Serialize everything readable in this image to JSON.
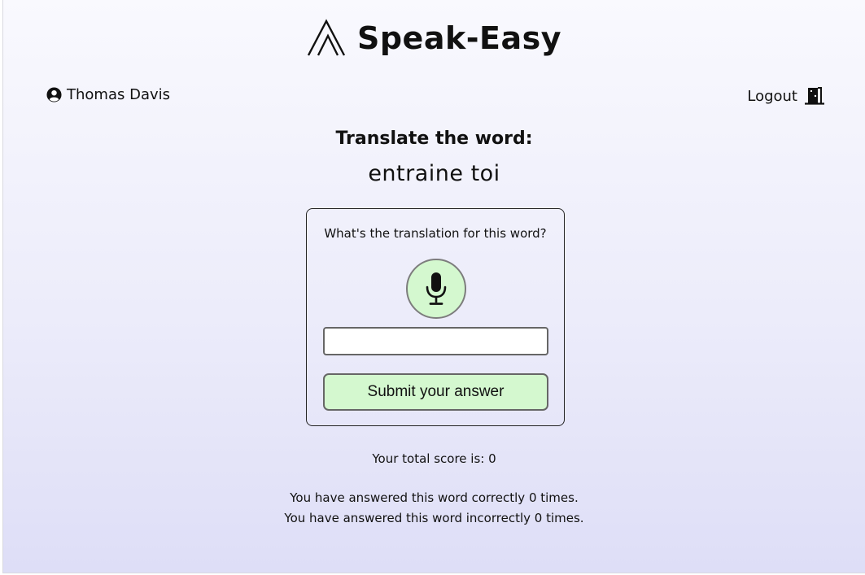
{
  "brand": {
    "name": "Speak-Easy",
    "logo_icon": "mountain-peak-logo"
  },
  "user": {
    "icon": "user-circle-icon",
    "name": "Thomas Davis"
  },
  "logout": {
    "label": "Logout",
    "icon": "door-exit-icon"
  },
  "lesson": {
    "prompt": "Translate the word:",
    "word": "entraine toi"
  },
  "card": {
    "question": "What's the translation for this word?",
    "mic_icon": "microphone-icon",
    "input_value": "",
    "input_placeholder": "",
    "submit_label": "Submit your answer"
  },
  "score": {
    "total_text": "Your total score is: 0",
    "correct_text": "You have answered this word correctly 0 times.",
    "incorrect_text": "You have answered this word incorrectly 0 times."
  },
  "colors": {
    "accent_green": "#d4f8cf",
    "background_top": "#f9f9fe",
    "background_bottom": "#dedef7"
  }
}
